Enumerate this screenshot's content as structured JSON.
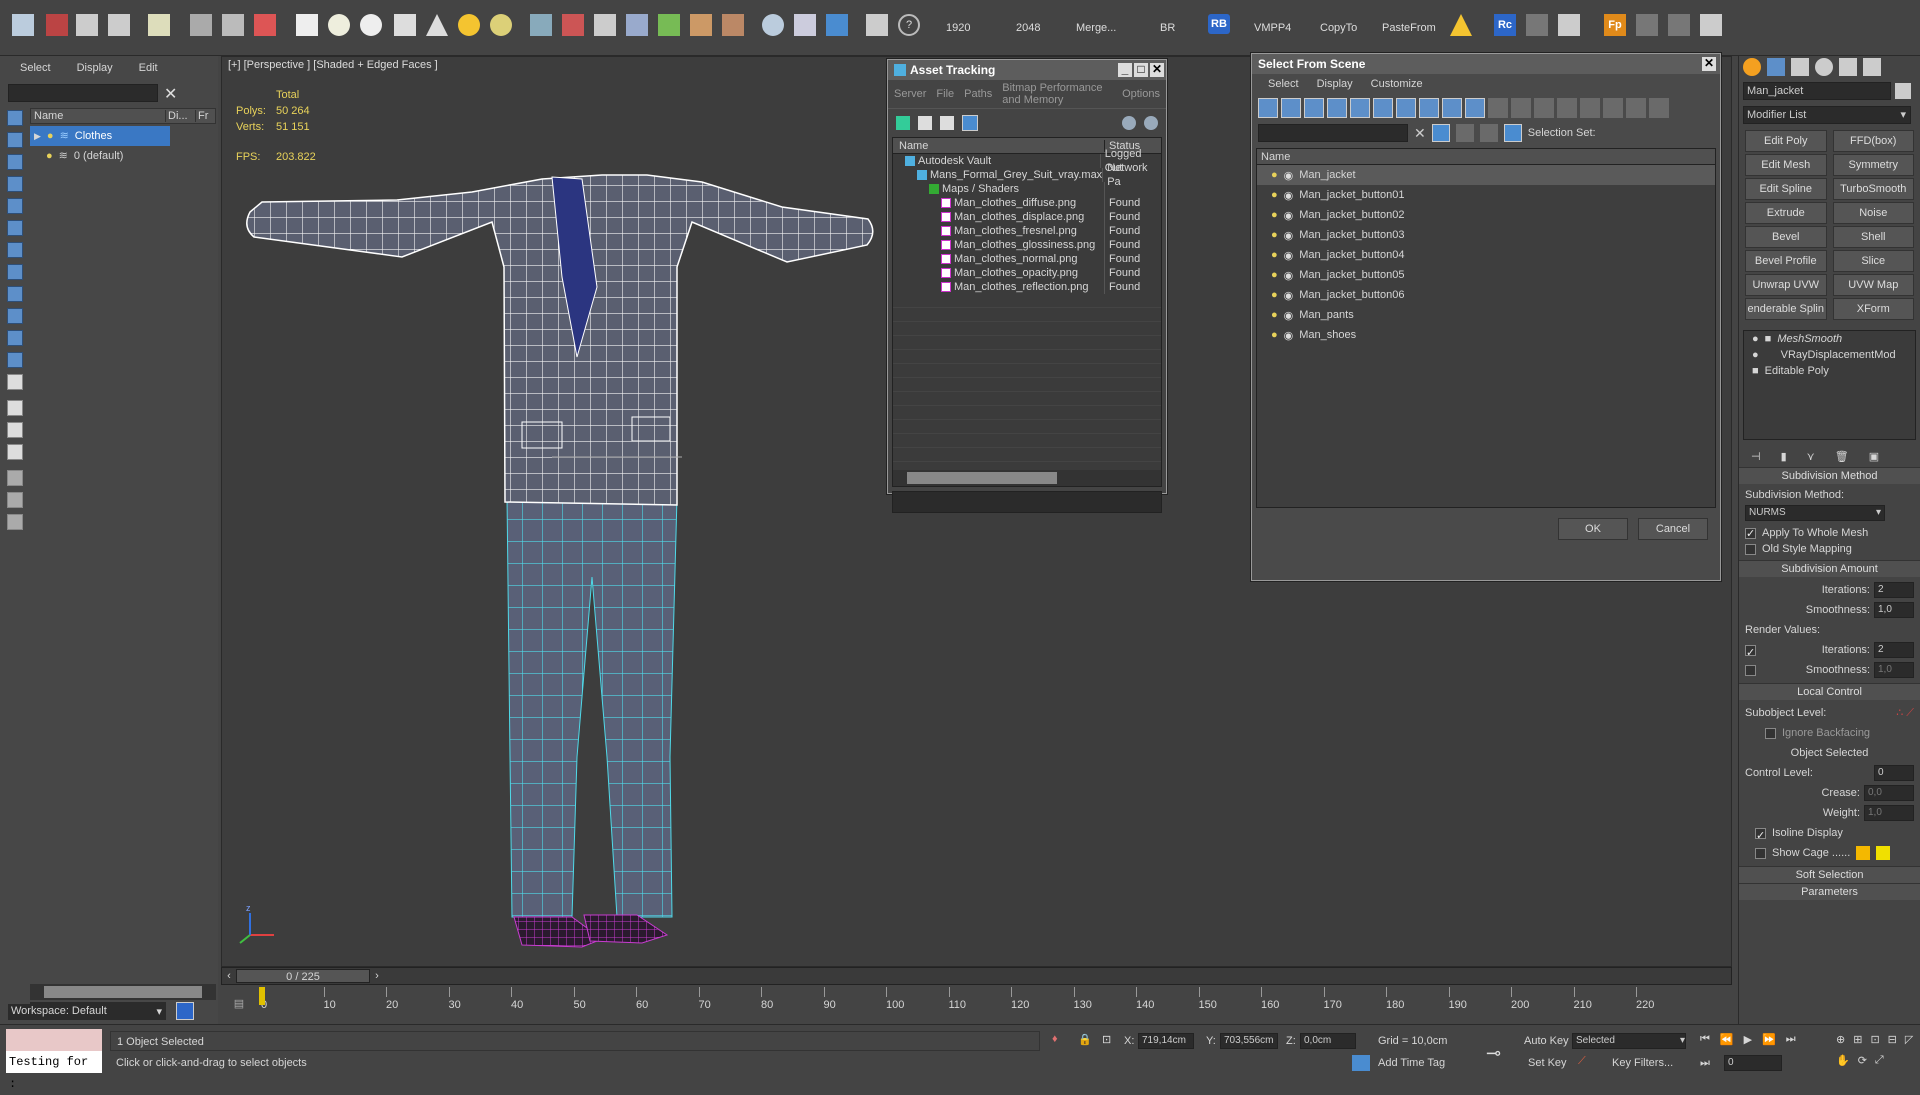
{
  "toolbar": {
    "labels": [
      "1920",
      "2048",
      "Merge...",
      "BR",
      "RB",
      "VMPP4",
      "CopyTo",
      "PasteFrom"
    ],
    "rc_label": "Rc",
    "fp_label": "Fp"
  },
  "explorer": {
    "menu": [
      "Select",
      "Display",
      "Edit"
    ],
    "col_name": "Name",
    "col_display": "Di...",
    "col_freeze": "Fr",
    "items": [
      {
        "label": "Clothes"
      },
      {
        "label": "0 (default)"
      }
    ],
    "workspace": "Workspace: Default"
  },
  "viewport": {
    "label": "[+] [Perspective ] [Shaded + Edged Faces ]",
    "stats": {
      "total": "Total",
      "polys_label": "Polys:",
      "polys": "50 264",
      "verts_label": "Verts:",
      "verts": "51 151",
      "fps_label": "FPS:",
      "fps": "203.822"
    },
    "axis_x": "x",
    "axis_y": "y",
    "axis_z": "z"
  },
  "asset_tracking": {
    "title": "Asset Tracking",
    "menu": [
      "Server",
      "File",
      "Paths",
      "Bitmap Performance and Memory",
      "Options"
    ],
    "col_name": "Name",
    "col_status": "Status",
    "rows": [
      {
        "name": "Autodesk Vault",
        "status": "Logged Out",
        "indent": 1,
        "icon": "vault-icon"
      },
      {
        "name": "Mans_Formal_Grey_Suit_vray.max",
        "status": "Network Pa",
        "indent": 2,
        "icon": "max-file-icon"
      },
      {
        "name": "Maps / Shaders",
        "status": "",
        "indent": 3,
        "icon": "maps-folder-icon"
      },
      {
        "name": "Man_clothes_diffuse.png",
        "status": "Found",
        "indent": 4,
        "icon": "png-icon"
      },
      {
        "name": "Man_clothes_displace.png",
        "status": "Found",
        "indent": 4,
        "icon": "png-icon"
      },
      {
        "name": "Man_clothes_fresnel.png",
        "status": "Found",
        "indent": 4,
        "icon": "png-icon"
      },
      {
        "name": "Man_clothes_glossiness.png",
        "status": "Found",
        "indent": 4,
        "icon": "png-icon"
      },
      {
        "name": "Man_clothes_normal.png",
        "status": "Found",
        "indent": 4,
        "icon": "png-icon"
      },
      {
        "name": "Man_clothes_opacity.png",
        "status": "Found",
        "indent": 4,
        "icon": "png-icon"
      },
      {
        "name": "Man_clothes_reflection.png",
        "status": "Found",
        "indent": 4,
        "icon": "png-icon"
      }
    ]
  },
  "select_scene": {
    "title": "Select From Scene",
    "menu": [
      "Select",
      "Display",
      "Customize"
    ],
    "selection_set_label": "Selection Set:",
    "col_name": "Name",
    "items": [
      "Man_jacket",
      "Man_jacket_button01",
      "Man_jacket_button02",
      "Man_jacket_button03",
      "Man_jacket_button04",
      "Man_jacket_button05",
      "Man_jacket_button06",
      "Man_pants",
      "Man_shoes"
    ],
    "ok": "OK",
    "cancel": "Cancel"
  },
  "command_panel": {
    "object_name": "Man_jacket",
    "modifier_list": "Modifier List",
    "buttons": [
      [
        "Edit Poly",
        "FFD(box)"
      ],
      [
        "Edit Mesh",
        "Symmetry"
      ],
      [
        "Edit Spline",
        "TurboSmooth"
      ],
      [
        "Extrude",
        "Noise"
      ],
      [
        "Bevel",
        "Shell"
      ],
      [
        "Bevel Profile",
        "Slice"
      ],
      [
        "Unwrap UVW",
        "UVW Map"
      ],
      [
        "enderable Splin",
        "XForm"
      ]
    ],
    "stack": [
      "MeshSmooth",
      "VRayDisplacementMod",
      "Editable Poly"
    ],
    "subdivision_method_title": "Subdivision Method",
    "subdivision_method_label": "Subdivision Method:",
    "subdivision_method_value": "NURMS",
    "apply_whole_mesh": "Apply To Whole Mesh",
    "old_style_mapping": "Old Style Mapping",
    "subdivision_amount_title": "Subdivision Amount",
    "iterations_label": "Iterations:",
    "iterations_value": "2",
    "smoothness_label": "Smoothness:",
    "smoothness_value": "1,0",
    "render_values_label": "Render Values:",
    "render_iterations_value": "2",
    "render_smoothness_value": "1,0",
    "local_control_title": "Local Control",
    "subobject_level_label": "Subobject Level:",
    "ignore_backfacing": "Ignore Backfacing",
    "object_selected": "Object Selected",
    "control_level_label": "Control Level:",
    "control_level_value": "0",
    "crease_label": "Crease:",
    "crease_value": "0,0",
    "weight_label": "Weight:",
    "weight_value": "1,0",
    "isoline_display": "Isoline Display",
    "show_cage": "Show Cage ......",
    "soft_selection_title": "Soft Selection",
    "parameters_title": "Parameters"
  },
  "timeline": {
    "frame_display": "0 / 225",
    "ticks": [
      "0",
      "10",
      "20",
      "30",
      "40",
      "50",
      "60",
      "70",
      "80",
      "90",
      "100",
      "110",
      "120",
      "130",
      "140",
      "150",
      "160",
      "170",
      "180",
      "190",
      "200",
      "210",
      "220"
    ]
  },
  "status": {
    "maxscript": "Testing for :",
    "selection": "1 Object Selected",
    "prompt": "Click or click-and-drag to select objects",
    "x_label": "X:",
    "x_value": "719,14cm",
    "y_label": "Y:",
    "y_value": "703,556cm",
    "z_label": "Z:",
    "z_value": "0,0cm",
    "grid": "Grid = 10,0cm",
    "add_time_tag": "Add Time Tag",
    "auto_key": "Auto Key",
    "set_key": "Set Key",
    "selected": "Selected",
    "key_filters": "Key Filters...",
    "frame": "0"
  },
  "colors": {
    "accent": "#5d8fc9",
    "stats_yellow": "#e8d25a",
    "jacket_wire": "#ffffff",
    "pants_wire": "#4fd9e8",
    "shoes_wire": "#c83cd0",
    "selection_blue": "#3a78c4"
  }
}
